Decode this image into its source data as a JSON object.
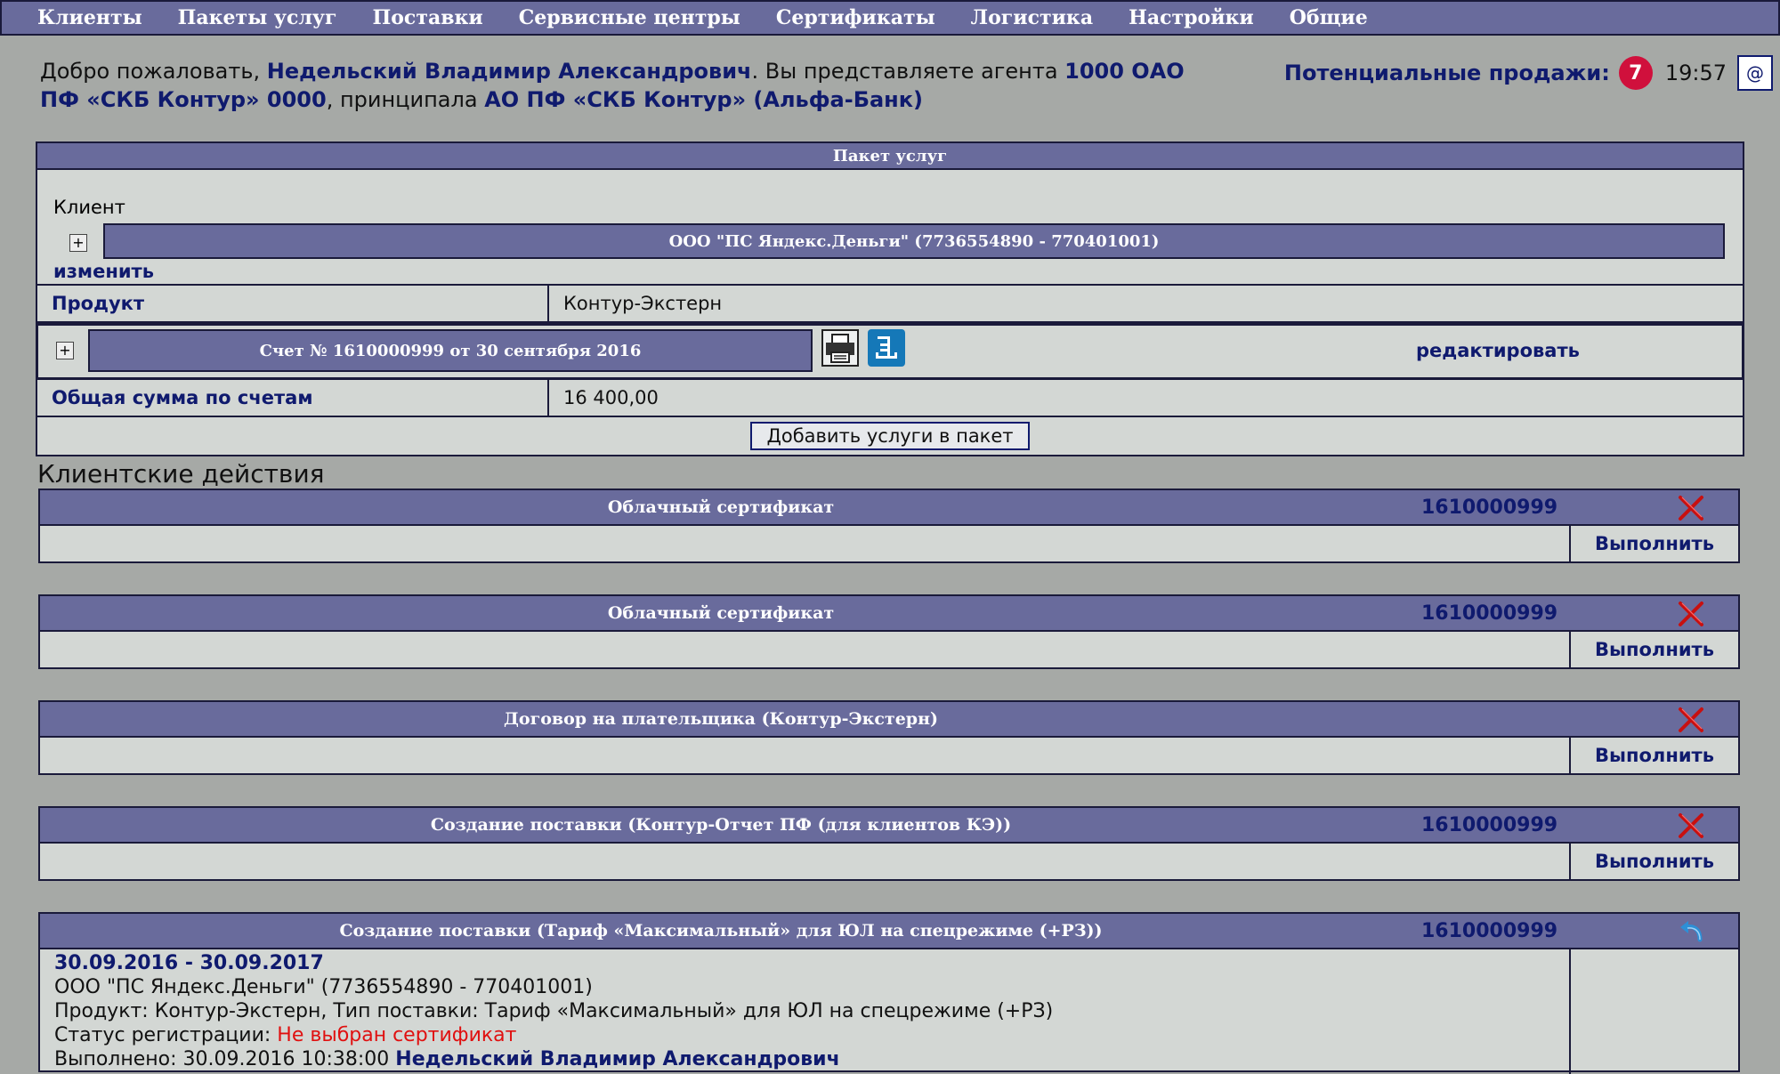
{
  "nav": {
    "items": [
      "Клиенты",
      "Пакеты услуг",
      "Поставки",
      "Сервисные центры",
      "Сертификаты",
      "Логистика",
      "Настройки",
      "Общие"
    ]
  },
  "welcome": {
    "prefix": "Добро пожаловать, ",
    "user": "Недельский Владимир Александрович",
    "agent_text": ". Вы представляете агента ",
    "agent": "1000 ОАО ПФ «СКБ Контур» 0000",
    "principal_text": ", принципала ",
    "principal": "АО ПФ «СКБ Контур» (Альфа-Банк)"
  },
  "status": {
    "potential_sales_label": "Потенциальные продажи:",
    "potential_sales_count": "7",
    "time": "19:57",
    "mail_button": "@"
  },
  "package": {
    "header": "Пакет услуг",
    "client_label": "Клиент",
    "client_name": "ООО \"ПС Яндекс.Деньги\" (7736554890 - 770401001)",
    "change_link": "изменить",
    "product_label": "Продукт",
    "product_value": "Контур-Экстерн",
    "invoice_title": "Счет № 1610000999 от 30 сентября 2016",
    "edit_link": "редактировать",
    "total_label": "Общая сумма по счетам",
    "total_value": "16 400,00",
    "add_button": "Добавить услуги в пакет"
  },
  "client_actions": {
    "title": "Клиентские действия",
    "items": [
      {
        "title": "Облачный сертификат",
        "number": "1610000999",
        "execute": "Выполнить"
      },
      {
        "title": "Облачный сертификат",
        "number": "1610000999",
        "execute": "Выполнить"
      },
      {
        "title": "Договор на плательщика (Контур-Экстерн)",
        "number": "",
        "execute": "Выполнить"
      },
      {
        "title": "Создание поставки (Контур-Отчет ПФ (для клиентов КЭ))",
        "number": "1610000999",
        "execute": "Выполнить"
      },
      {
        "title": "Создание поставки (Тариф «Максимальный» для ЮЛ на спецрежиме (+РЗ))",
        "number": "1610000999",
        "period": "30.09.2016 - 30.09.2017",
        "client": "ООО \"ПС Яндекс.Деньги\" (7736554890 - 770401001)",
        "product_line": "Продукт: Контур-Экстерн, Тип поставки: Тариф «Максимальный» для ЮЛ на спецрежиме (+РЗ)",
        "reg_status_label": "Статус регистрации: ",
        "reg_status_value": "Не выбран сертификат",
        "done_label": "Выполнено: 30.09.2016 10:38:00 ",
        "done_by": "Недельский Владимир Александрович"
      }
    ]
  },
  "colors": {
    "bar": "#696b9c",
    "page_bg": "#a6a9a6",
    "panel_bg": "#d3d7d4",
    "dark_blue": "#0f1a6e",
    "badge_red": "#d0103c",
    "status_red": "#e01010"
  },
  "icons": [
    "expand-plus-icon",
    "printer-icon",
    "export-icon",
    "delete-x-icon",
    "undo-arrow-icon"
  ]
}
